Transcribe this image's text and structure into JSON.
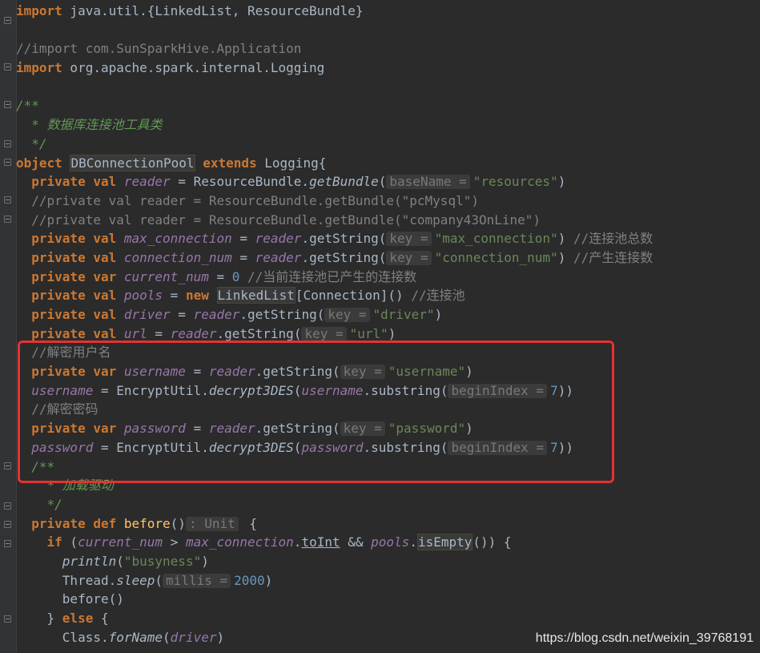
{
  "editor": {
    "lines": [
      [
        [
          "kw",
          "import"
        ],
        [
          "t",
          " java.util.{LinkedList, ResourceBundle}"
        ]
      ],
      [],
      [
        [
          "cmt",
          "//import com.SunSparkHive.Application"
        ]
      ],
      [
        [
          "kw",
          "import"
        ],
        [
          "t",
          " org.apache.spark.internal.Logging"
        ]
      ],
      [],
      [
        [
          "doc",
          "/**"
        ]
      ],
      [
        [
          "doc",
          "  * 数据库连接池工具类"
        ]
      ],
      [
        [
          "doc",
          "  */"
        ]
      ],
      [
        [
          "kw",
          "object"
        ],
        [
          "t",
          " "
        ],
        [
          "caret",
          ""
        ],
        [
          "cls",
          "DBConnectionPool"
        ],
        [
          "t",
          " "
        ],
        [
          "kw",
          "extends"
        ],
        [
          "t",
          " Logging{"
        ]
      ],
      [
        [
          "t",
          "  "
        ],
        [
          "kw",
          "private val"
        ],
        [
          "t",
          " "
        ],
        [
          "fld",
          "reader"
        ],
        [
          "t",
          " = ResourceBundle."
        ],
        [
          "ital",
          "getBundle"
        ],
        [
          "t",
          "("
        ],
        [
          "hint",
          "baseName ="
        ],
        [
          "str",
          "\"resources\""
        ],
        [
          "t",
          ")"
        ]
      ],
      [
        [
          "cmt",
          "  //private val reader = ResourceBundle.getBundle(\"pcMysql\")"
        ]
      ],
      [
        [
          "cmt",
          "  //private val reader = ResourceBundle.getBundle(\"company43OnLine\")"
        ]
      ],
      [
        [
          "t",
          "  "
        ],
        [
          "kw",
          "private val"
        ],
        [
          "t",
          " "
        ],
        [
          "fld",
          "max_connection"
        ],
        [
          "t",
          " = "
        ],
        [
          "fld",
          "reader"
        ],
        [
          "t",
          ".getString("
        ],
        [
          "hint",
          "key ="
        ],
        [
          "str",
          "\"max_connection\""
        ],
        [
          "t",
          ") "
        ],
        [
          "cmt",
          "//连接池总数"
        ]
      ],
      [
        [
          "t",
          "  "
        ],
        [
          "kw",
          "private val"
        ],
        [
          "t",
          " "
        ],
        [
          "fld",
          "connection_num"
        ],
        [
          "t",
          " = "
        ],
        [
          "fld",
          "reader"
        ],
        [
          "t",
          ".getString("
        ],
        [
          "hint",
          "key ="
        ],
        [
          "str",
          "\"connection_num\""
        ],
        [
          "t",
          ") "
        ],
        [
          "cmt",
          "//产生连接数"
        ]
      ],
      [
        [
          "t",
          "  "
        ],
        [
          "kw",
          "private var"
        ],
        [
          "t",
          " "
        ],
        [
          "fld",
          "current_num"
        ],
        [
          "t",
          " = "
        ],
        [
          "num",
          "0"
        ],
        [
          "t",
          " "
        ],
        [
          "cmt",
          "//当前连接池已产生的连接数"
        ]
      ],
      [
        [
          "t",
          "  "
        ],
        [
          "kw",
          "private val"
        ],
        [
          "t",
          " "
        ],
        [
          "fld",
          "pools"
        ],
        [
          "t",
          " = "
        ],
        [
          "kw",
          "new"
        ],
        [
          "t",
          " "
        ],
        [
          "cls",
          "LinkedList"
        ],
        [
          "t",
          "[Connection]() "
        ],
        [
          "cmt",
          "//连接池"
        ]
      ],
      [
        [
          "t",
          "  "
        ],
        [
          "kw",
          "private val"
        ],
        [
          "t",
          " "
        ],
        [
          "fld",
          "driver"
        ],
        [
          "t",
          " = "
        ],
        [
          "fld",
          "reader"
        ],
        [
          "t",
          ".getString("
        ],
        [
          "hint",
          "key ="
        ],
        [
          "str",
          "\"driver\""
        ],
        [
          "t",
          ")"
        ]
      ],
      [
        [
          "t",
          "  "
        ],
        [
          "kw",
          "private val"
        ],
        [
          "t",
          " "
        ],
        [
          "fld",
          "url"
        ],
        [
          "t",
          " = "
        ],
        [
          "fld",
          "reader"
        ],
        [
          "t",
          ".getString("
        ],
        [
          "hint",
          "key ="
        ],
        [
          "str",
          "\"url\""
        ],
        [
          "t",
          ")"
        ]
      ],
      [
        [
          "cmt",
          "  //解密用户名"
        ]
      ],
      [
        [
          "t",
          "  "
        ],
        [
          "kw",
          "private var"
        ],
        [
          "t",
          " "
        ],
        [
          "fld",
          "username"
        ],
        [
          "t",
          " = "
        ],
        [
          "fld",
          "reader"
        ],
        [
          "t",
          ".getString("
        ],
        [
          "hint",
          "key ="
        ],
        [
          "str",
          "\"username\""
        ],
        [
          "t",
          ")"
        ]
      ],
      [
        [
          "t",
          "  "
        ],
        [
          "fld",
          "username"
        ],
        [
          "t",
          " = EncryptUtil."
        ],
        [
          "ital",
          "decrypt3DES"
        ],
        [
          "t",
          "("
        ],
        [
          "fld",
          "username"
        ],
        [
          "t",
          ".substring("
        ],
        [
          "hint",
          "beginIndex ="
        ],
        [
          "num",
          "7"
        ],
        [
          "t",
          "))"
        ]
      ],
      [
        [
          "cmt",
          "  //解密密码"
        ]
      ],
      [
        [
          "t",
          "  "
        ],
        [
          "kw",
          "private var"
        ],
        [
          "t",
          " "
        ],
        [
          "fld",
          "password"
        ],
        [
          "t",
          " = "
        ],
        [
          "fld",
          "reader"
        ],
        [
          "t",
          ".getString("
        ],
        [
          "hint",
          "key ="
        ],
        [
          "str",
          "\"password\""
        ],
        [
          "t",
          ")"
        ]
      ],
      [
        [
          "t",
          "  "
        ],
        [
          "fld",
          "password"
        ],
        [
          "t",
          " = EncryptUtil."
        ],
        [
          "ital",
          "decrypt3DES"
        ],
        [
          "t",
          "("
        ],
        [
          "fld",
          "password"
        ],
        [
          "t",
          ".substring("
        ],
        [
          "hint",
          "beginIndex ="
        ],
        [
          "num",
          "7"
        ],
        [
          "t",
          "))"
        ]
      ],
      [
        [
          "doc",
          "  /**"
        ]
      ],
      [
        [
          "doc",
          "    * 加载驱动"
        ]
      ],
      [
        [
          "doc",
          "    */"
        ]
      ],
      [
        [
          "t",
          "  "
        ],
        [
          "kw",
          "private def"
        ],
        [
          "t",
          " "
        ],
        [
          "fn",
          "before"
        ],
        [
          "t",
          "()"
        ],
        [
          "hint",
          ": Unit"
        ],
        [
          "t",
          " {"
        ]
      ],
      [
        [
          "t",
          "    "
        ],
        [
          "kw",
          "if"
        ],
        [
          "t",
          " ("
        ],
        [
          "fld",
          "current_num"
        ],
        [
          "t",
          " > "
        ],
        [
          "fld",
          "max_connection"
        ],
        [
          "t",
          "."
        ],
        [
          "lnk",
          "toInt"
        ],
        [
          "t",
          " && "
        ],
        [
          "fld",
          "pools"
        ],
        [
          "t",
          "."
        ],
        [
          "cls",
          "isEmpty"
        ],
        [
          "t",
          "()) {"
        ]
      ],
      [
        [
          "t",
          "      "
        ],
        [
          "ital",
          "println"
        ],
        [
          "t",
          "("
        ],
        [
          "str",
          "\"busyness\""
        ],
        [
          "t",
          ")"
        ]
      ],
      [
        [
          "t",
          "      Thread."
        ],
        [
          "ital",
          "sleep"
        ],
        [
          "t",
          "("
        ],
        [
          "hint",
          "millis ="
        ],
        [
          "num",
          "2000"
        ],
        [
          "t",
          ")"
        ]
      ],
      [
        [
          "t",
          "      before()"
        ]
      ],
      [
        [
          "t",
          "    } "
        ],
        [
          "kw",
          "else"
        ],
        [
          "t",
          " {"
        ]
      ],
      [
        [
          "t",
          "      Class."
        ],
        [
          "ital",
          "forName"
        ],
        [
          "t",
          "("
        ],
        [
          "fld",
          "driver"
        ],
        [
          "t",
          ")"
        ]
      ]
    ]
  },
  "watermark": "https://blog.csdn.net/weixin_39768191"
}
